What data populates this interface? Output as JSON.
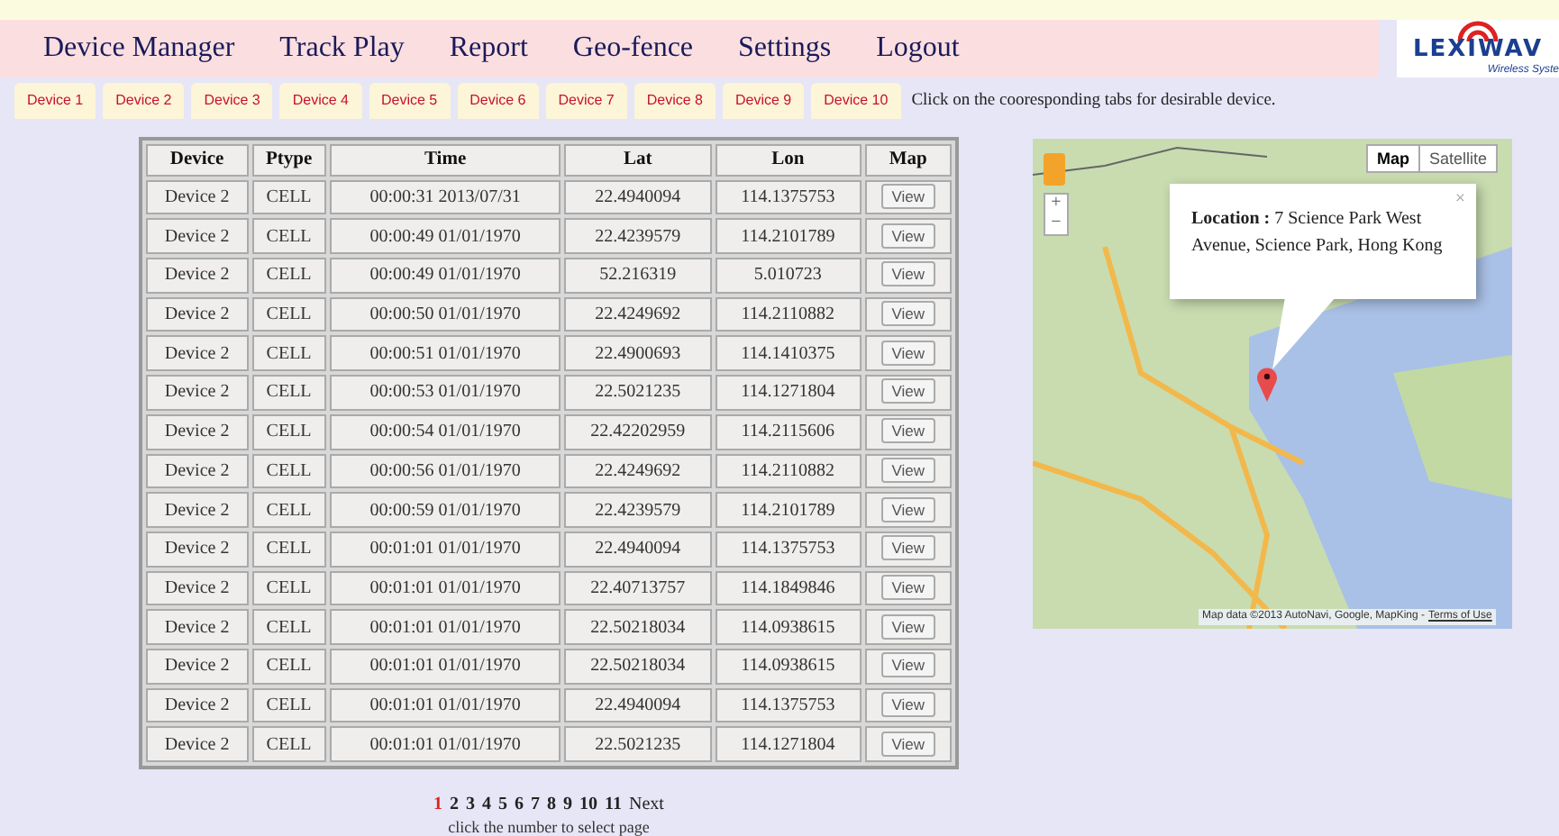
{
  "nav": {
    "items": [
      "Device Manager",
      "Track Play",
      "Report",
      "Geo-fence",
      "Settings",
      "Logout"
    ]
  },
  "logo": {
    "name": "LEXIWAV",
    "tagline": "Wireless Syste"
  },
  "device_tabs": {
    "items": [
      "Device 1",
      "Device 2",
      "Device 3",
      "Device 4",
      "Device 5",
      "Device 6",
      "Device 7",
      "Device 8",
      "Device 9",
      "Device 10"
    ],
    "hint": "Click on the cooresponding tabs for desirable device."
  },
  "table": {
    "columns": [
      "Device",
      "Ptype",
      "Time",
      "Lat",
      "Lon",
      "Map"
    ],
    "rows": [
      [
        "Device 2",
        "CELL",
        "00:00:31 2013/07/31",
        "22.4940094",
        "114.1375753",
        "View"
      ],
      [
        "Device 2",
        "CELL",
        "00:00:49 01/01/1970",
        "22.4239579",
        "114.2101789",
        "View"
      ],
      [
        "Device 2",
        "CELL",
        "00:00:49 01/01/1970",
        "52.216319",
        "5.010723",
        "View"
      ],
      [
        "Device 2",
        "CELL",
        "00:00:50 01/01/1970",
        "22.4249692",
        "114.2110882",
        "View"
      ],
      [
        "Device 2",
        "CELL",
        "00:00:51 01/01/1970",
        "22.4900693",
        "114.1410375",
        "View"
      ],
      [
        "Device 2",
        "CELL",
        "00:00:53 01/01/1970",
        "22.5021235",
        "114.1271804",
        "View"
      ],
      [
        "Device 2",
        "CELL",
        "00:00:54 01/01/1970",
        "22.42202959",
        "114.2115606",
        "View"
      ],
      [
        "Device 2",
        "CELL",
        "00:00:56 01/01/1970",
        "22.4249692",
        "114.2110882",
        "View"
      ],
      [
        "Device 2",
        "CELL",
        "00:00:59 01/01/1970",
        "22.4239579",
        "114.2101789",
        "View"
      ],
      [
        "Device 2",
        "CELL",
        "00:01:01 01/01/1970",
        "22.4940094",
        "114.1375753",
        "View"
      ],
      [
        "Device 2",
        "CELL",
        "00:01:01 01/01/1970",
        "22.40713757",
        "114.1849846",
        "View"
      ],
      [
        "Device 2",
        "CELL",
        "00:01:01 01/01/1970",
        "22.50218034",
        "114.0938615",
        "View"
      ],
      [
        "Device 2",
        "CELL",
        "00:01:01 01/01/1970",
        "22.50218034",
        "114.0938615",
        "View"
      ],
      [
        "Device 2",
        "CELL",
        "00:01:01 01/01/1970",
        "22.4940094",
        "114.1375753",
        "View"
      ],
      [
        "Device 2",
        "CELL",
        "00:01:01 01/01/1970",
        "22.5021235",
        "114.1271804",
        "View"
      ]
    ]
  },
  "pagination": {
    "pages": [
      {
        "label": "1",
        "selected": true
      },
      {
        "label": "2",
        "selected": false
      },
      {
        "label": "3",
        "selected": false
      },
      {
        "label": "4",
        "selected": false
      },
      {
        "label": "5",
        "selected": false
      },
      {
        "label": "6",
        "selected": false
      },
      {
        "label": "7",
        "selected": false
      },
      {
        "label": "8",
        "selected": false
      },
      {
        "label": "9",
        "selected": false
      },
      {
        "label": "10",
        "selected": false
      },
      {
        "label": "11",
        "selected": false
      }
    ],
    "next": "Next",
    "hint": "click the number to select page"
  },
  "map": {
    "map_types": [
      {
        "label": "Map",
        "selected": true
      },
      {
        "label": "Satellite",
        "selected": false
      }
    ],
    "zoom_in": "+",
    "zoom_out": "−",
    "info": {
      "label": "Location :",
      "text": "7 Science Park West Avenue, Science Park, Hong Kong",
      "close": "×"
    },
    "attribution": "Map data ©2013 AutoNavi, Google, MapKing -",
    "terms": "Terms of Use"
  }
}
